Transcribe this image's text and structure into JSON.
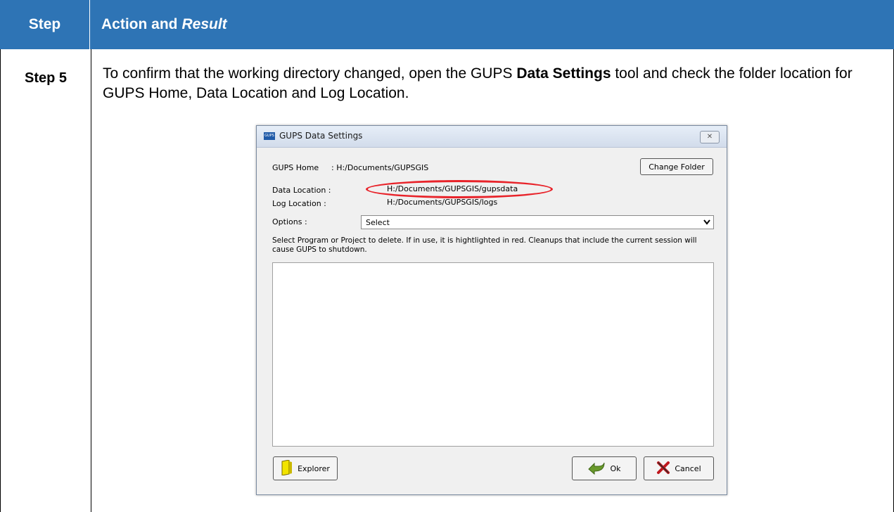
{
  "header": {
    "step_col": "Step",
    "action_col_plain": "Action and",
    "action_col_italic": "Result"
  },
  "row": {
    "step_label": "Step 5",
    "instruction_before": "To confirm that the working directory changed, open the GUPS ",
    "instruction_bold": "Data Settings",
    "instruction_after": " tool and check the folder location for GUPS Home, Data Location and Log Location."
  },
  "dialog": {
    "app_icon_text": "GUPS",
    "title": "GUPS Data Settings",
    "close_glyph": "✕",
    "gups_home_label": "GUPS Home",
    "gups_home_value": ": H:/Documents/GUPSGIS",
    "change_folder_label": "Change Folder",
    "data_location_label": "Data Location  :",
    "data_location_value": "H:/Documents/GUPSGIS/gupsdata",
    "log_location_label": "Log Location   :",
    "log_location_value": "H:/Documents/GUPSGIS/logs",
    "options_label": "Options :",
    "options_selected": "Select",
    "note": "Select Program or Project to delete. If in use, it is hightlighted in red. Cleanups that include the current session will cause GUPS to shutdown.",
    "explorer_label": "Explorer",
    "ok_label": "Ok",
    "cancel_label": "Cancel"
  },
  "colors": {
    "header_bg": "#2E74B5",
    "highlight": "#e8232a"
  },
  "icons": [
    "close-icon",
    "folder-icon",
    "ok-arrow-icon",
    "cancel-x-icon",
    "chevron-down-icon",
    "gups-app-icon"
  ]
}
